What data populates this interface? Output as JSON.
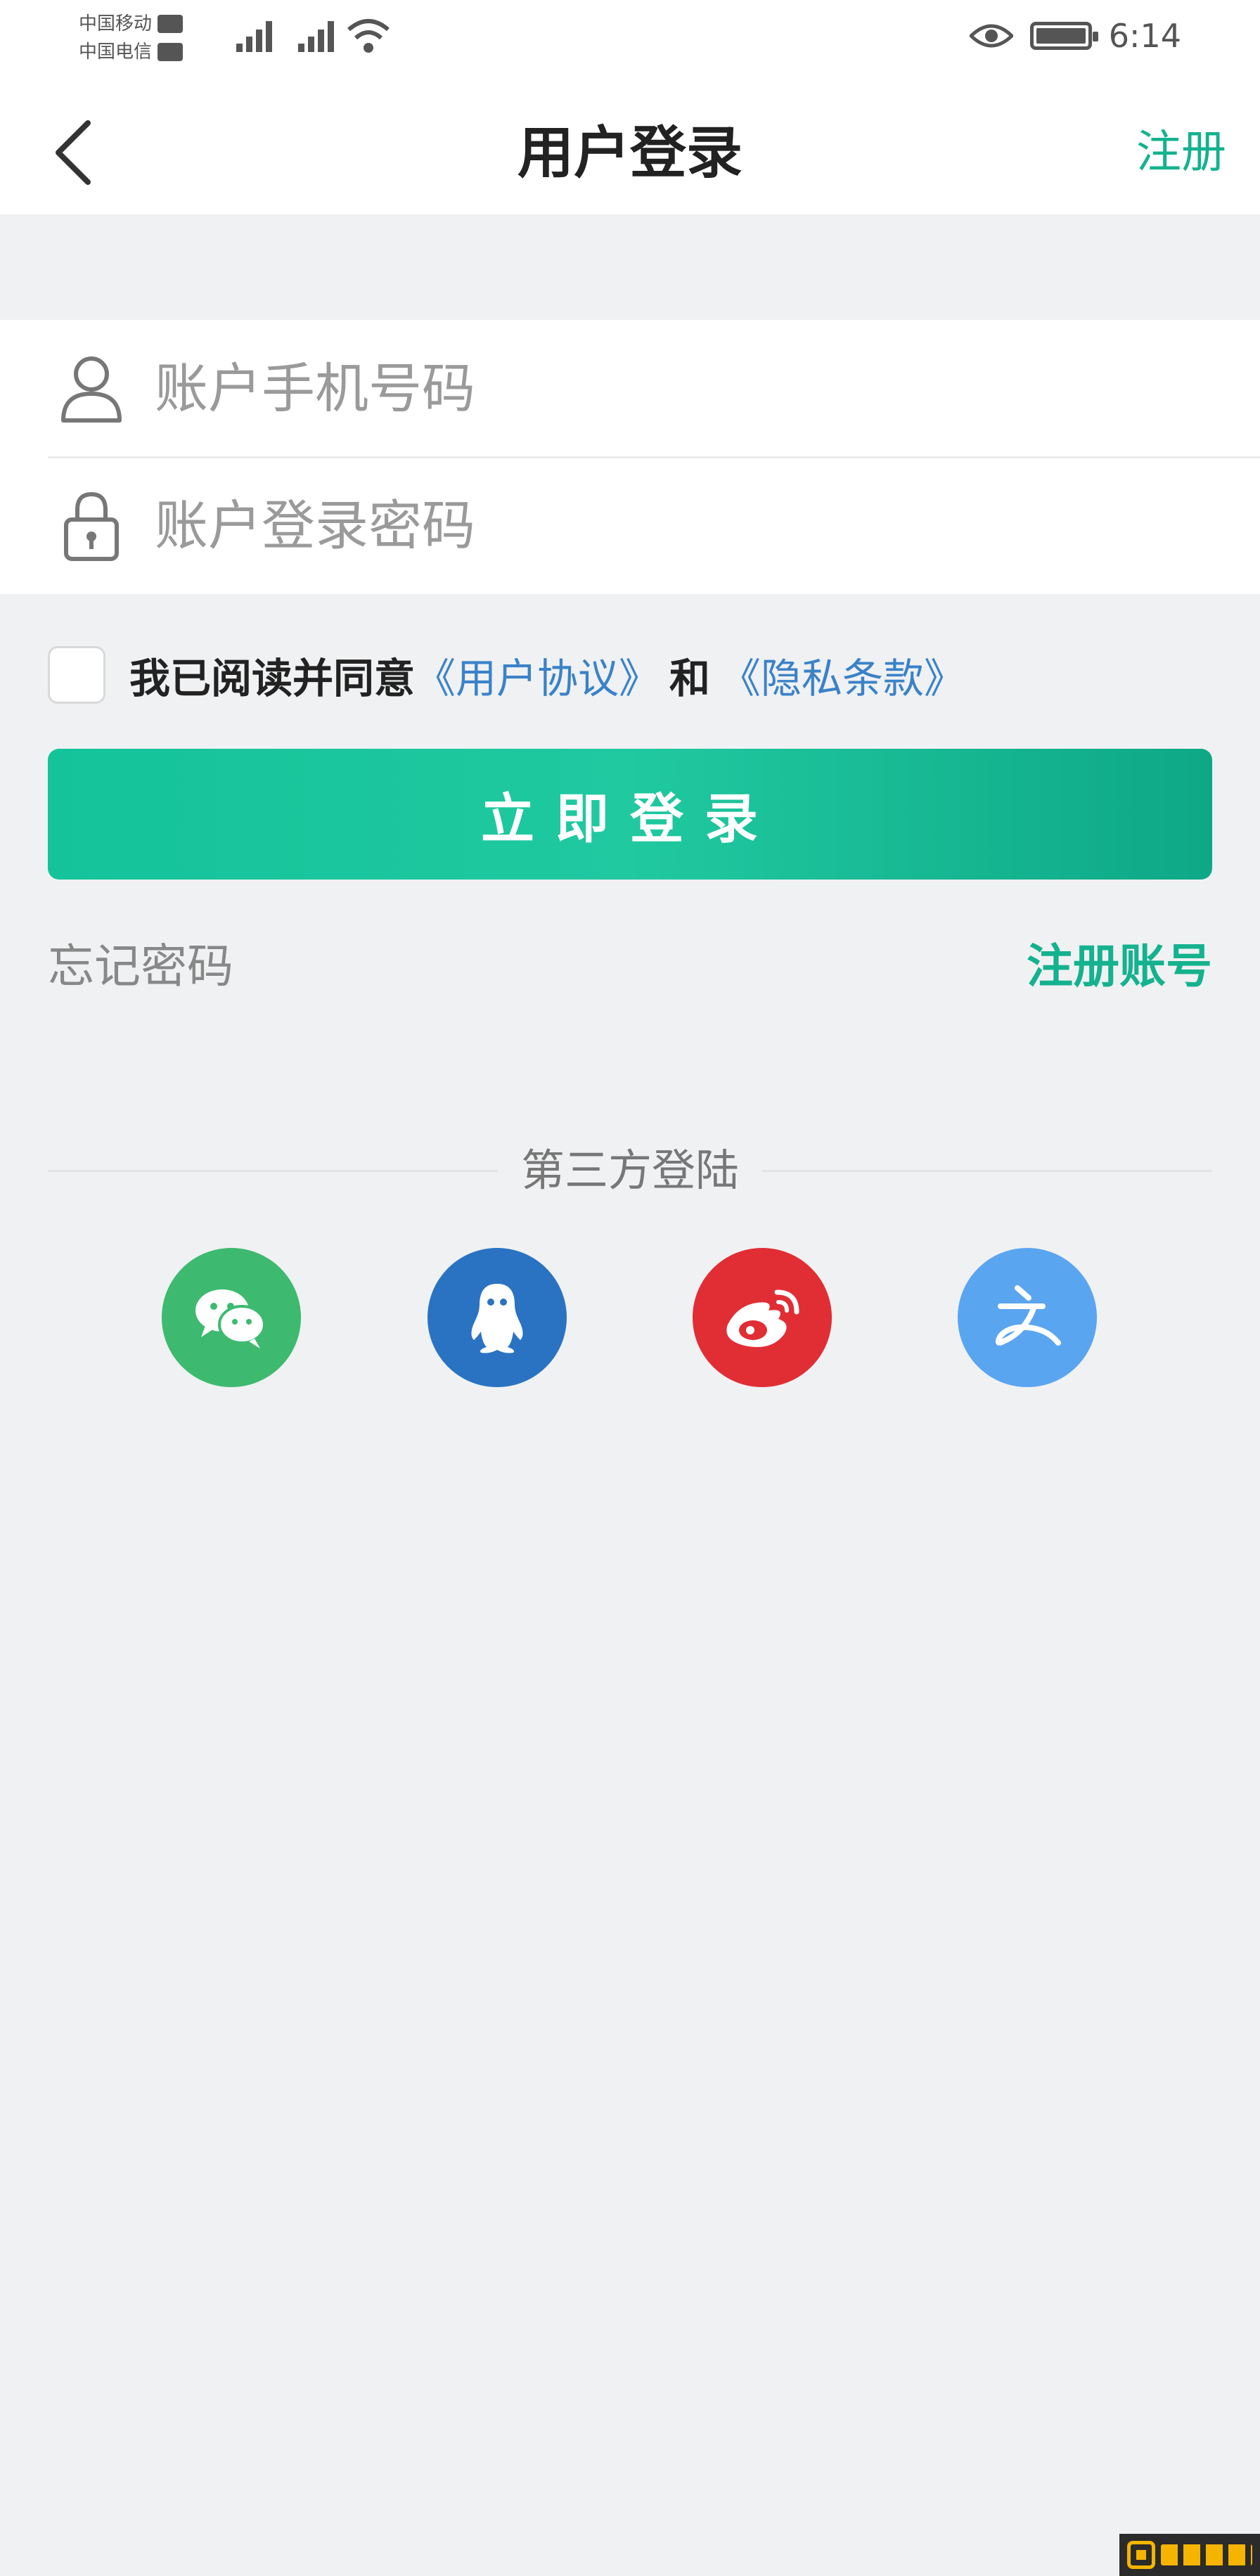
{
  "status_bar": {
    "carrier_1": "中国移动",
    "carrier_2": "中国电信",
    "time": "6:14"
  },
  "nav": {
    "title": "用户登录",
    "register_label": "注册"
  },
  "form": {
    "phone_placeholder": "账户手机号码",
    "password_placeholder": "账户登录密码"
  },
  "agreement": {
    "checked": false,
    "prefix": "我已阅读并同意",
    "user_agreement": "《用户协议》",
    "and": "和",
    "privacy_policy": "《隐私条款》"
  },
  "login_button_label": "立即登录",
  "links": {
    "forgot_password": "忘记密码",
    "register_account": "注册账号"
  },
  "third_party": {
    "label": "第三方登陆",
    "providers": [
      {
        "name": "wechat-icon",
        "color": "#3dba6f"
      },
      {
        "name": "qq-icon",
        "color": "#2a73c2"
      },
      {
        "name": "weibo-icon",
        "color": "#e02e34"
      },
      {
        "name": "alipay-icon",
        "color": "#5aa5f0"
      }
    ]
  },
  "colors": {
    "accent": "#14b28e",
    "link_blue": "#3a82c8",
    "background": "#f0f1f3"
  }
}
